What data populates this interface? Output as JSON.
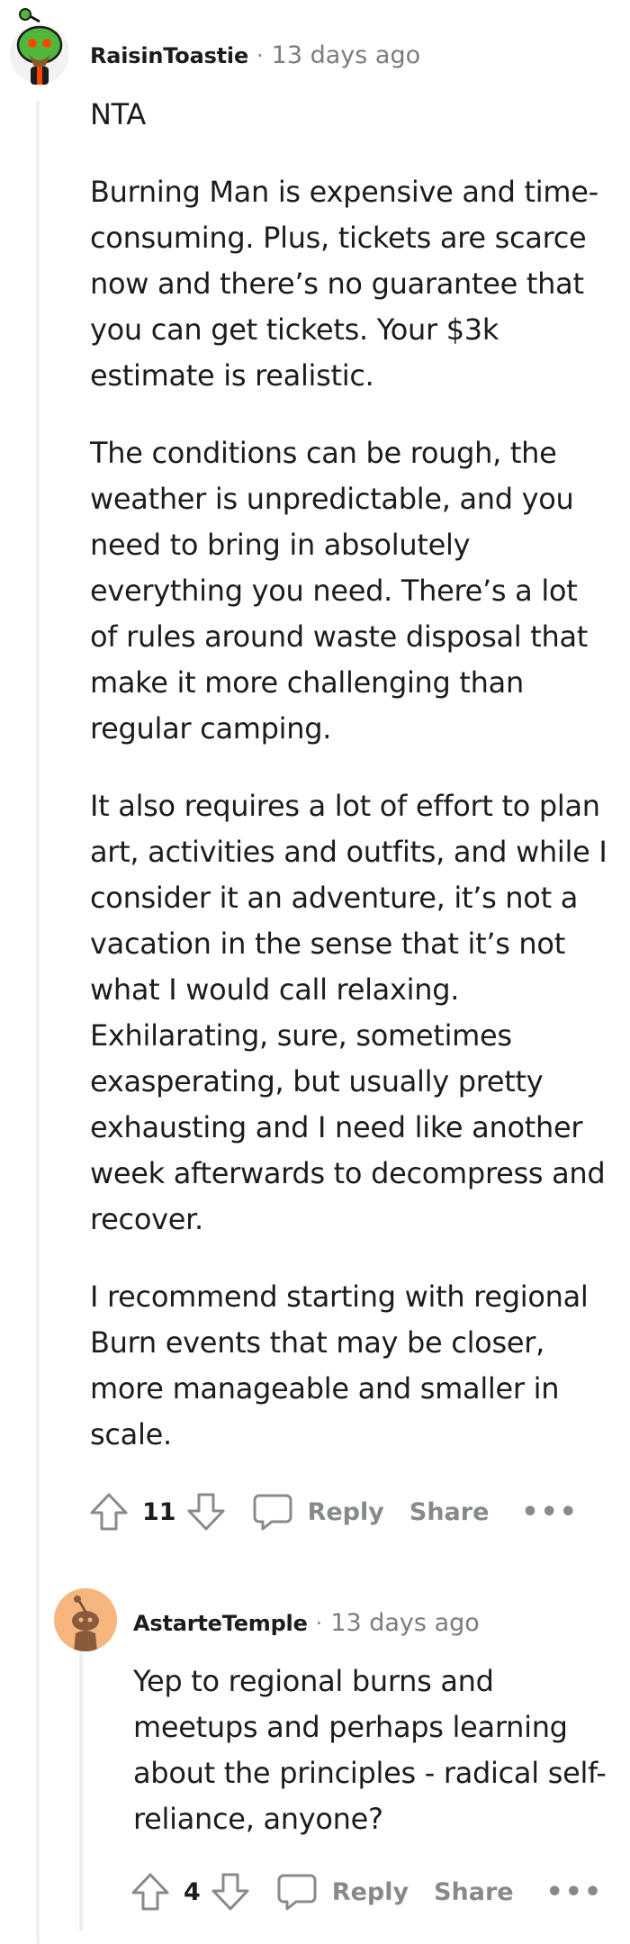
{
  "comments": [
    {
      "username": "RaisinToastie",
      "time": "13 days ago",
      "paragraphs": [
        "NTA",
        "Burning Man is expensive and time-consuming. Plus, tickets are scarce now and there’s no guarantee that you can get tickets. Your $3k estimate is realistic.",
        "The conditions can be rough, the weather is unpredictable, and you need to bring in absolutely everything you need. There’s a lot of rules around waste disposal that make it more challenging than regular camping.",
        "It also requires a lot of effort to plan art, activities and outfits, and while I consider it an adventure, it’s not a vacation in the sense that it’s not what I would call relaxing. Exhilarating, sure, sometimes exasperating, but usually pretty exhausting and I need like another week afterwards to decompress and recover.",
        "I recommend starting with regional Burn events that may be closer, more manageable and smaller in scale."
      ],
      "votes": "11",
      "reply_label": "Reply",
      "share_label": "Share",
      "more_label": "•••"
    },
    {
      "username": "AstarteTemple",
      "time": "13 days ago",
      "paragraphs": [
        "Yep to regional burns and meetups and perhaps learning about the principles - radical self-reliance, anyone?"
      ],
      "votes": "4",
      "reply_label": "Reply",
      "share_label": "Share",
      "more_label": "•••"
    }
  ],
  "separator": "·",
  "colors": {
    "text": "#1c1c1c",
    "meta": "#878a8c",
    "thread_line": "#edeff1",
    "avatar1_head": "#4fb83c",
    "avatar1_eyes": "#ff4500",
    "avatar2_bg": "#f6b67d"
  },
  "icons": {
    "upvote": "upvote-arrow-icon",
    "downvote": "downvote-arrow-icon",
    "reply": "speech-bubble-icon",
    "more": "ellipsis-icon"
  }
}
